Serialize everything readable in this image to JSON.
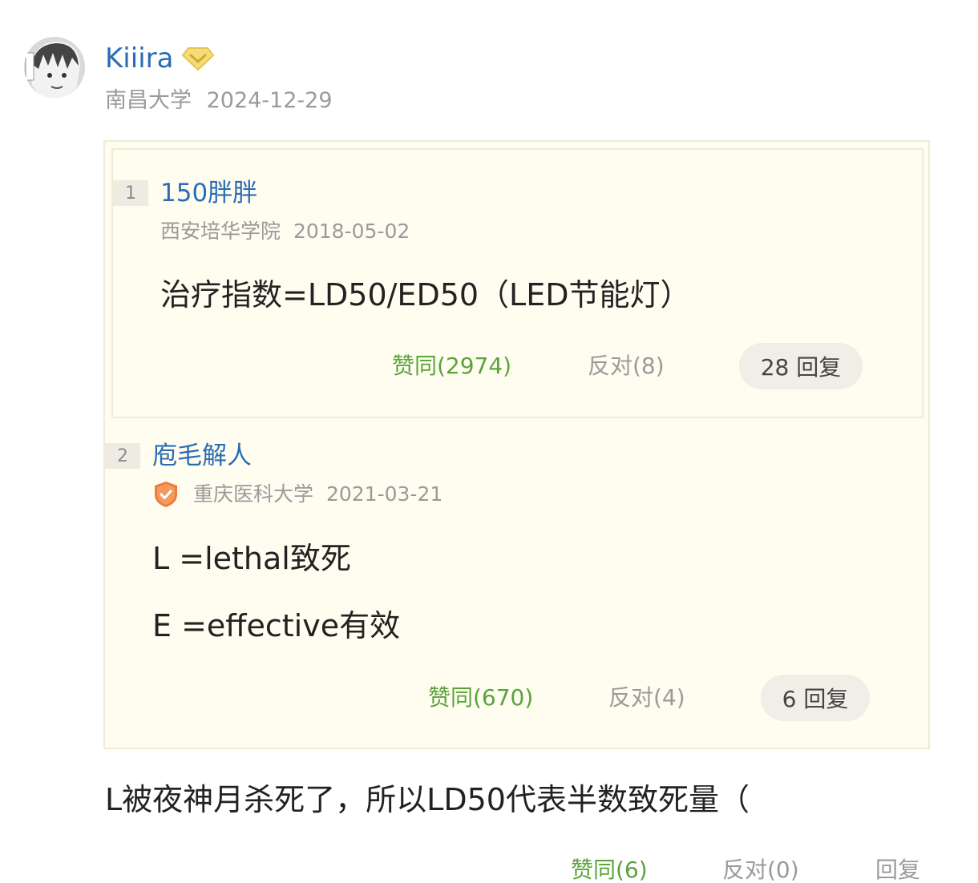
{
  "post": {
    "author": "Kiiira",
    "school": "南昌大学",
    "date": "2024-12-29",
    "body": "L被夜神月杀死了，所以LD50代表半数致死量（",
    "agree_label": "赞同(6)",
    "disagree_label": "反对(0)",
    "reply_label": "回复"
  },
  "quotes": [
    {
      "floor": "1",
      "author": "150胖胖",
      "school": "西安培华学院",
      "date": "2018-05-02",
      "lines": [
        "治疗指数=LD50/ED50（LED节能灯）"
      ],
      "agree_label": "赞同(2974)",
      "disagree_label": "反对(8)",
      "reply_label": "28 回复"
    },
    {
      "floor": "2",
      "author": "庖毛解人",
      "school": "重庆医科大学",
      "date": "2021-03-21",
      "lines": [
        "L =lethal致死",
        "E =effective有效"
      ],
      "agree_label": "赞同(670)",
      "disagree_label": "反对(4)",
      "reply_label": "6 回复"
    }
  ],
  "colors": {
    "link_blue": "#2a6db5",
    "agree_green": "#5aa33a",
    "muted_gray": "#9a9a9a",
    "quote_bg": "#fffdf0",
    "vip_gold": "#e8c54a",
    "shield_orange": "#ef7a3c"
  },
  "icons": {
    "vip": "diamond-icon",
    "verified": "shield-check-icon"
  }
}
